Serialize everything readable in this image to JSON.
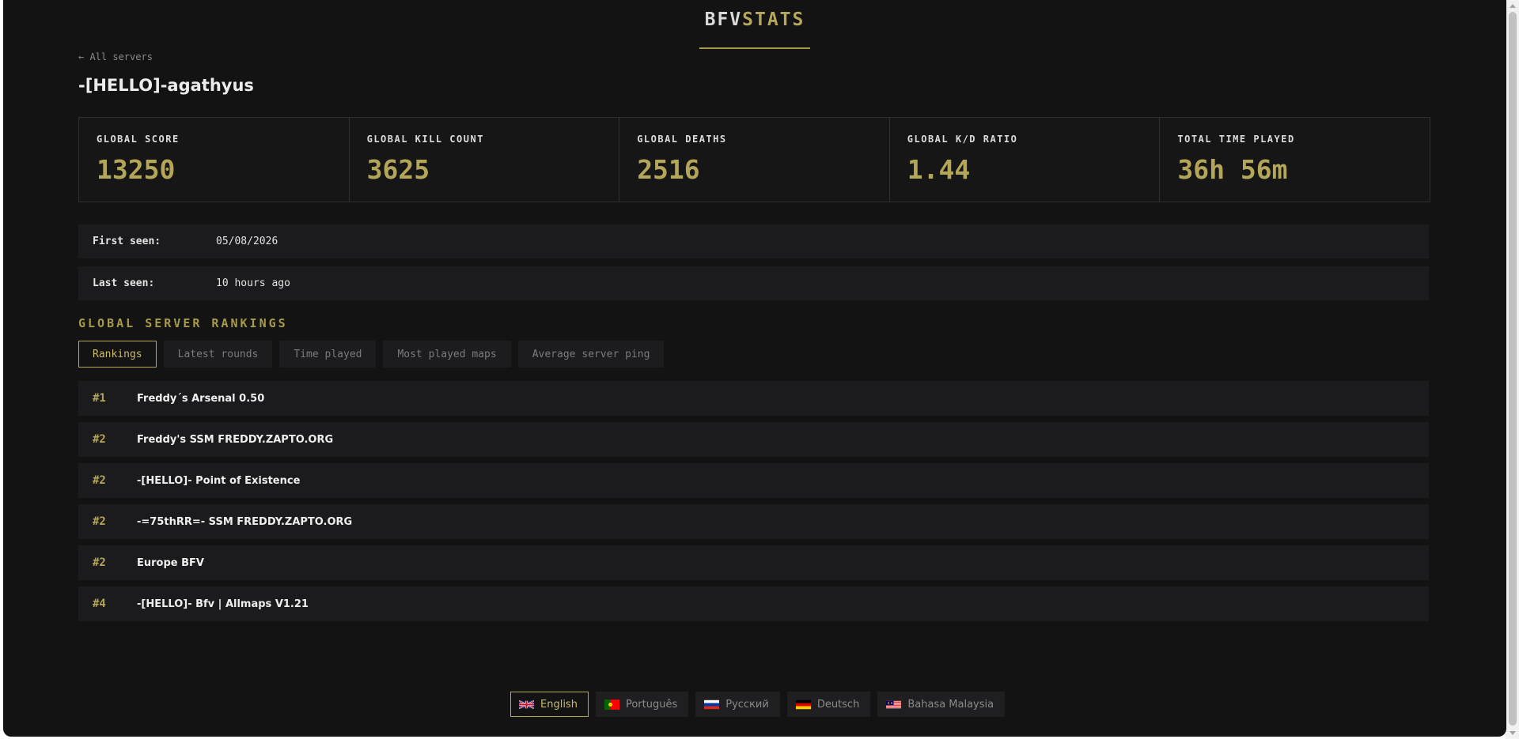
{
  "brand": {
    "part1": "BFV",
    "part2": "STATS"
  },
  "back_link": "← All servers",
  "player_name": "-[HELLO]-agathyus",
  "stats": [
    {
      "label": "GLOBAL SCORE",
      "value": "13250"
    },
    {
      "label": "GLOBAL KILL COUNT",
      "value": "3625"
    },
    {
      "label": "GLOBAL DEATHS",
      "value": "2516"
    },
    {
      "label": "GLOBAL K/D RATIO",
      "value": "1.44"
    },
    {
      "label": "TOTAL TIME PLAYED",
      "value": "36h 56m"
    }
  ],
  "info": {
    "first_seen_label": "First seen:",
    "first_seen_value": "05/08/2026",
    "last_seen_label": "Last seen:",
    "last_seen_value": "10 hours ago"
  },
  "section_title": "GLOBAL SERVER RANKINGS",
  "tabs": [
    {
      "label": "Rankings",
      "active": true
    },
    {
      "label": "Latest rounds"
    },
    {
      "label": "Time played"
    },
    {
      "label": "Most played maps"
    },
    {
      "label": "Average server ping"
    }
  ],
  "rankings": [
    {
      "rank": "#1",
      "server": "Freddy´s Arsenal 0.50"
    },
    {
      "rank": "#2",
      "server": "Freddy's SSM FREDDY.ZAPTO.ORG"
    },
    {
      "rank": "#2",
      "server": "-[HELLO]- Point of Existence"
    },
    {
      "rank": "#2",
      "server": "-=75thRR=- SSM FREDDY.ZAPTO.ORG"
    },
    {
      "rank": "#2",
      "server": "Europe BFV"
    },
    {
      "rank": "#4",
      "server": "-[HELLO]- Bfv | Allmaps V1.21"
    }
  ],
  "languages": [
    {
      "label": "English",
      "flag": "uk-flag-icon",
      "active": true
    },
    {
      "label": "Português",
      "flag": "portugal-flag-icon"
    },
    {
      "label": "Русский",
      "flag": "russia-flag-icon"
    },
    {
      "label": "Deutsch",
      "flag": "germany-flag-icon"
    },
    {
      "label": "Bahasa Malaysia",
      "flag": "malaysia-flag-icon"
    }
  ],
  "colors": {
    "accent": "#b3a658",
    "background": "#131313",
    "row": "#1b1b1d"
  }
}
